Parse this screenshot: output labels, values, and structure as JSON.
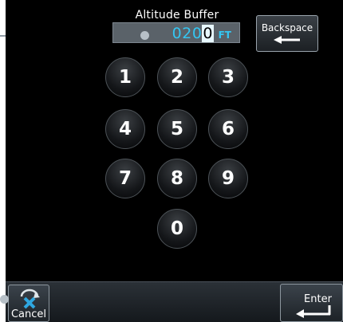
{
  "dialog": {
    "title": "Altitude Buffer",
    "value_prefix": "020",
    "value_cursor_digit": "0",
    "unit": "FT"
  },
  "keypad": {
    "keys": [
      "1",
      "2",
      "3",
      "4",
      "5",
      "6",
      "7",
      "8",
      "9",
      "0"
    ]
  },
  "buttons": {
    "backspace_label": "Backspace",
    "cancel_label": "Cancel",
    "enter_label": "Enter"
  },
  "colors": {
    "value_text": "#34c6f2",
    "background": "#000000",
    "field_bg": "#5a6269"
  }
}
